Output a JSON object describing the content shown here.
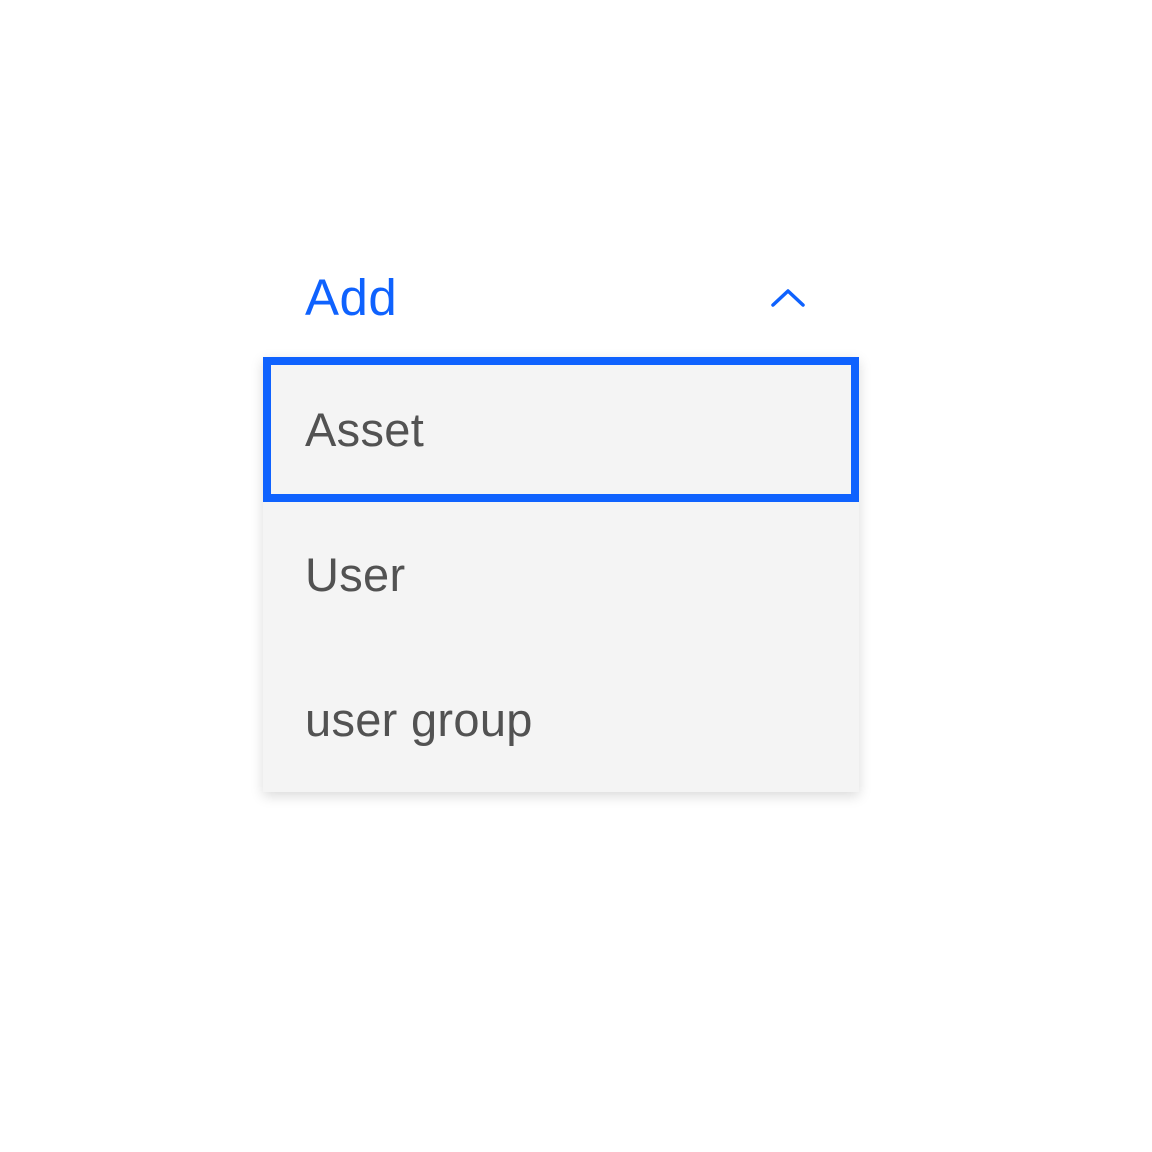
{
  "dropdown": {
    "trigger_label": "Add",
    "options": [
      {
        "label": "Asset",
        "selected": true
      },
      {
        "label": "User",
        "selected": false
      },
      {
        "label": "user group",
        "selected": false
      }
    ]
  }
}
